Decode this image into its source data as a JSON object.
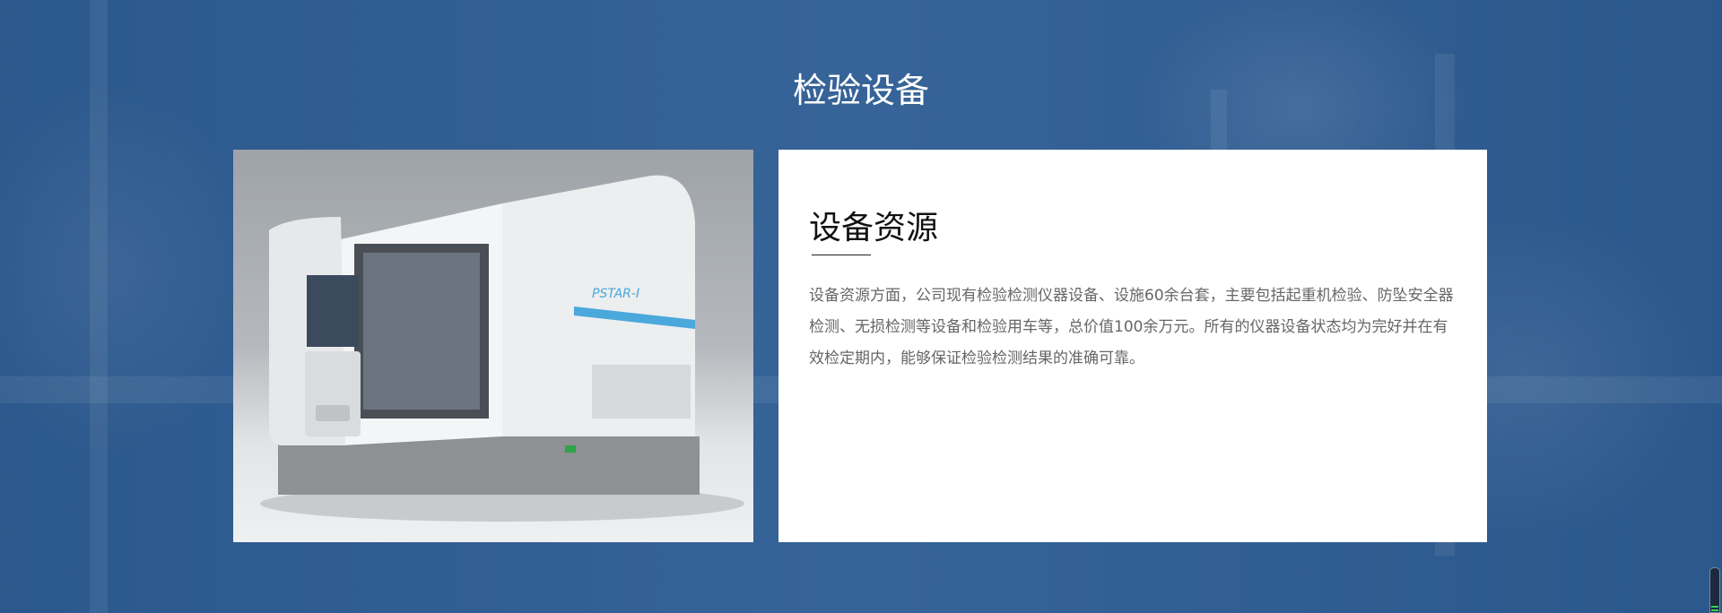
{
  "section_title": "检验设备",
  "card": {
    "heading": "设备资源",
    "body": "设备资源方面，公司现有检验检测仪器设备、设施60余台套，主要包括起重机检验、防坠安全器检测、无损检测等设备和检验用车等，总价值100余万元。所有的仪器设备状态均为完好并在有效检定期内，能够保证检验检测结果的准确可靠。"
  },
  "photo": {
    "label": "PSTAR-I"
  }
}
